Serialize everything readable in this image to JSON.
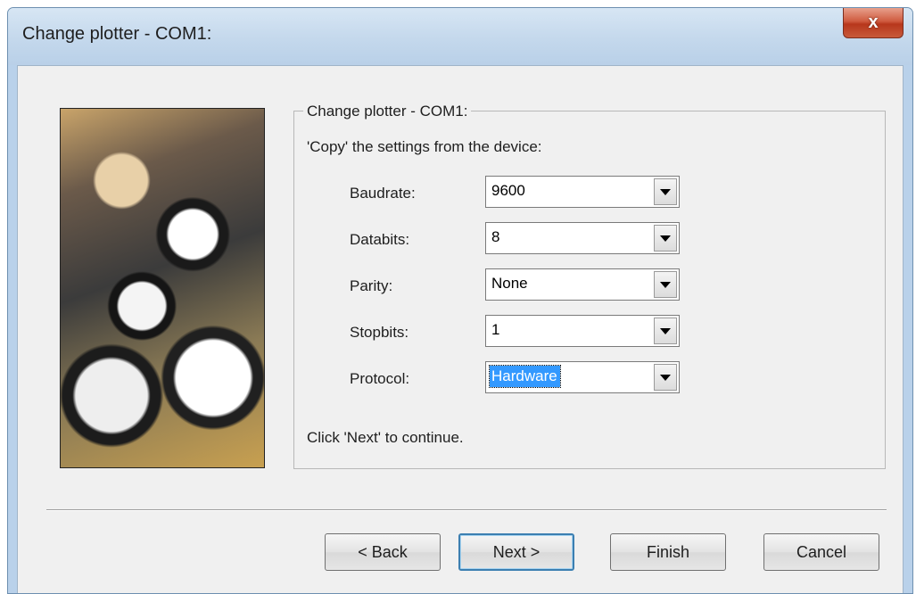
{
  "window": {
    "title": "Change plotter - COM1:",
    "close_label": "x"
  },
  "group": {
    "title": "Change plotter - COM1:",
    "copy_label": "'Copy' the settings from the device:",
    "hint": "Click 'Next' to continue."
  },
  "fields": {
    "baudrate": {
      "label": "Baudrate:",
      "value": "9600"
    },
    "databits": {
      "label": "Databits:",
      "value": "8"
    },
    "parity": {
      "label": "Parity:",
      "value": "None"
    },
    "stopbits": {
      "label": "Stopbits:",
      "value": "1"
    },
    "protocol": {
      "label": "Protocol:",
      "value": "Hardware"
    }
  },
  "buttons": {
    "back": "< Back",
    "next": "Next >",
    "finish": "Finish",
    "cancel": "Cancel"
  },
  "colors": {
    "selection": "#3399ff",
    "default_button_border": "#3c7fb1",
    "close_button": "#c85a3a"
  }
}
